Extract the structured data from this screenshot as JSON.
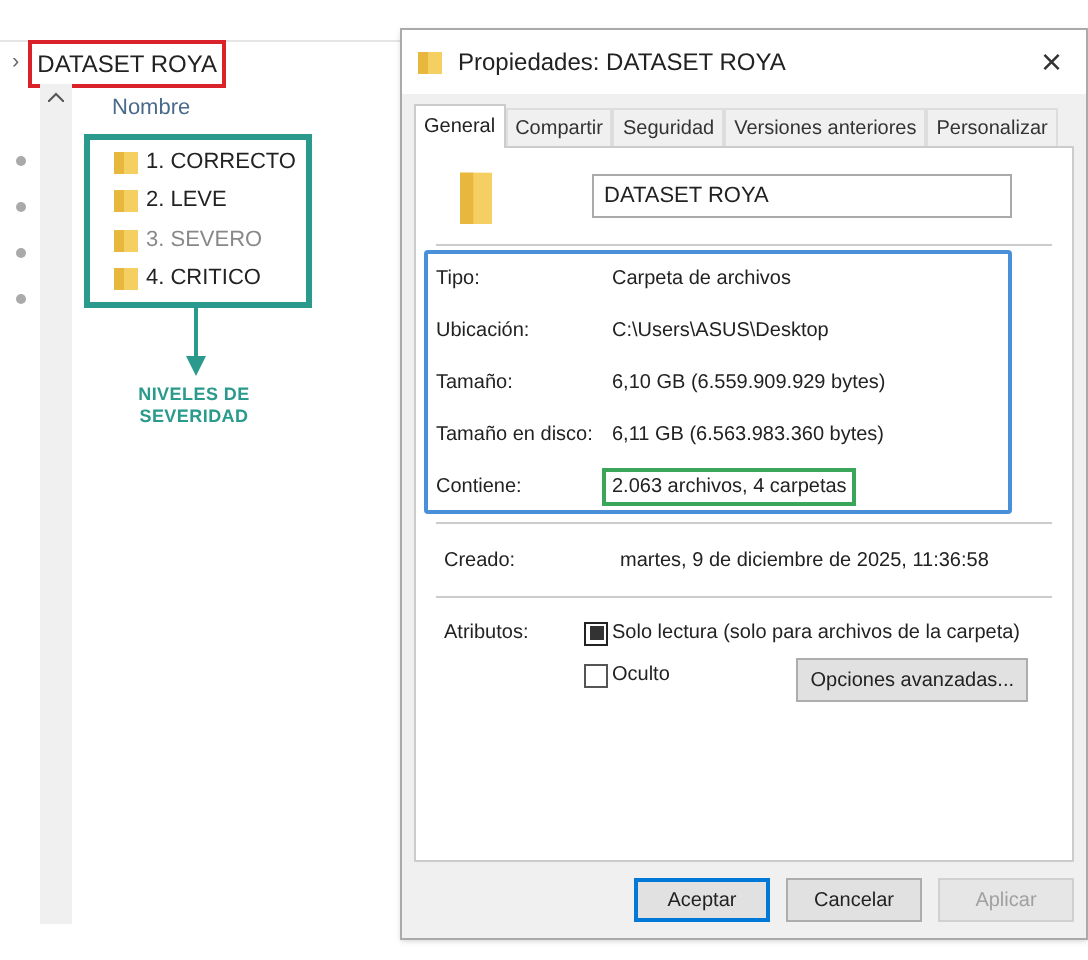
{
  "explorer": {
    "breadcrumb_arrow": "›",
    "breadcrumb": "DATASET ROYA",
    "column_header": "Nombre",
    "folders": [
      {
        "name": "1. CORRECTO",
        "dimmed": false
      },
      {
        "name": "2. LEVE",
        "dimmed": false
      },
      {
        "name": "3. SEVERO",
        "dimmed": true
      },
      {
        "name": "4. CRITICO",
        "dimmed": false
      }
    ],
    "annotation": "NIVELES DE SEVERIDAD"
  },
  "dialog": {
    "title": "Propiedades: DATASET ROYA",
    "close": "×",
    "tabs": [
      {
        "label": "General",
        "selected": true
      },
      {
        "label": "Compartir",
        "selected": false
      },
      {
        "label": "Seguridad",
        "selected": false
      },
      {
        "label": "Versiones anteriores",
        "selected": false
      },
      {
        "label": "Personalizar",
        "selected": false
      }
    ],
    "name_field": "DATASET ROYA",
    "properties": [
      {
        "label": "Tipo:",
        "value": "Carpeta de archivos",
        "highlighted": false
      },
      {
        "label": "Ubicación:",
        "value": "C:\\Users\\ASUS\\Desktop",
        "highlighted": false
      },
      {
        "label": "Tamaño:",
        "value": "6,10 GB (6.559.909.929 bytes)",
        "highlighted": false
      },
      {
        "label": "Tamaño en disco:",
        "value": "6,11 GB (6.563.983.360 bytes)",
        "highlighted": false
      },
      {
        "label": "Contiene:",
        "value": "2.063 archivos, 4 carpetas",
        "highlighted": true
      }
    ],
    "created": {
      "label": "Creado:",
      "value": "martes, 9 de diciembre de 2025, 11:36:58"
    },
    "attributes_label": "Atributos:",
    "attributes": [
      {
        "label": "Solo lectura (solo para archivos de la carpeta)",
        "checked": true,
        "mixed": true
      },
      {
        "label": "Oculto",
        "checked": false,
        "mixed": false
      }
    ],
    "advanced_button": "Opciones avanzadas...",
    "buttons": [
      {
        "label": "Aceptar",
        "default": true,
        "disabled": false
      },
      {
        "label": "Cancelar",
        "default": false,
        "disabled": false
      },
      {
        "label": "Aplicar",
        "default": false,
        "disabled": true
      }
    ]
  }
}
